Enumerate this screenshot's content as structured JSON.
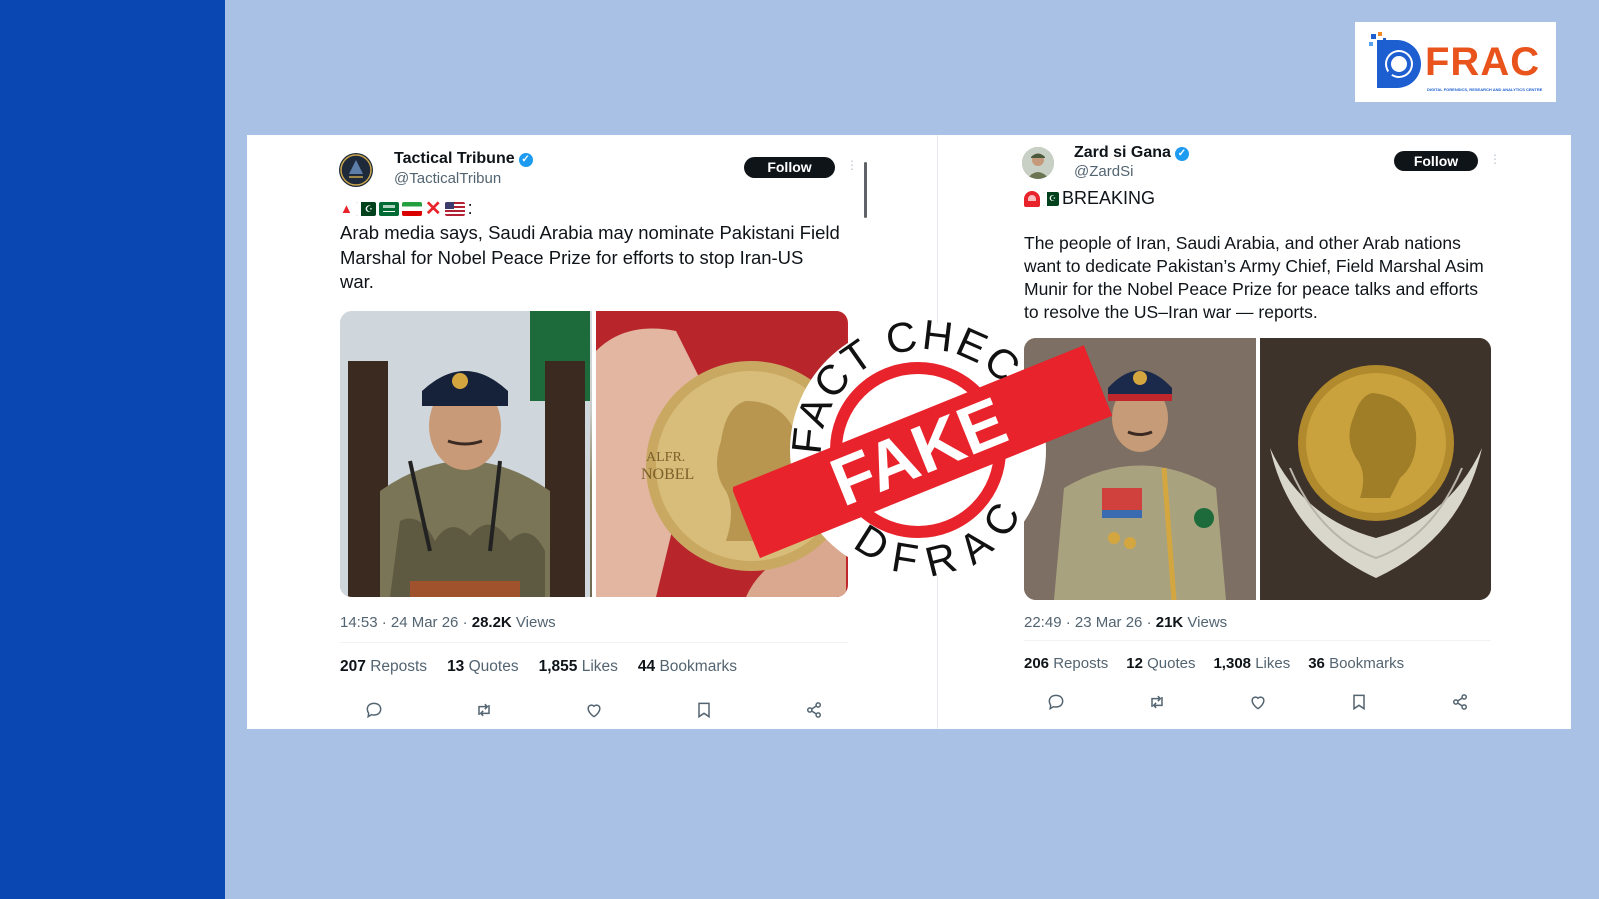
{
  "logo": {
    "text": "FRAC",
    "tagline": "DIGITAL FORENSICS, RESEARCH AND ANALYTICS CENTRE"
  },
  "stamp": {
    "top_text": "FACT CHECK",
    "bottom_text": "DFRAC",
    "label": "FAKE"
  },
  "tweet1": {
    "name": "Tactical Tribune",
    "handle": "@TacticalTribun",
    "follow_label": "Follow",
    "flags_suffix": ":",
    "text": "Arab media says, Saudi Arabia may nominate Pakistani Field Marshal for Nobel Peace Prize for efforts to stop Iran-US war.",
    "time": "14:53 · 24 Mar 26 · ",
    "views_count": "28.2K",
    "views_label": " Views",
    "reposts": "207",
    "reposts_label": "Reposts",
    "quotes": "13",
    "quotes_label": "Quotes",
    "likes": "1,855",
    "likes_label": "Likes",
    "bookmarks": "44",
    "bookmarks_label": "Bookmarks",
    "medal_text_1": "ALFR.",
    "medal_text_2": "NOBEL"
  },
  "tweet2": {
    "name": "Zard si Gana",
    "handle": "@ZardSi",
    "follow_label": "Follow",
    "headline": "BREAKING",
    "text": "The people of Iran, Saudi Arabia, and other Arab nations want to dedicate Pakistan’s Army Chief, Field Marshal Asim Munir for the Nobel Peace Prize for peace talks and efforts to resolve the US–Iran war — reports.",
    "time": "22:49 · 23 Mar 26 · ",
    "views_count": "21K",
    "views_label": " Views",
    "reposts": "206",
    "reposts_label": "Reposts",
    "quotes": "12",
    "quotes_label": "Quotes",
    "likes": "1,308",
    "likes_label": "Likes",
    "bookmarks": "36",
    "bookmarks_label": "Bookmarks"
  },
  "icons": [
    "reply-icon",
    "repost-icon",
    "like-icon",
    "bookmark-icon",
    "share-icon"
  ],
  "colors": {
    "sidebar": "#0a47b3",
    "background": "#a9c1e4",
    "fake_red": "#e8232b",
    "verified": "#1d9bf0"
  }
}
